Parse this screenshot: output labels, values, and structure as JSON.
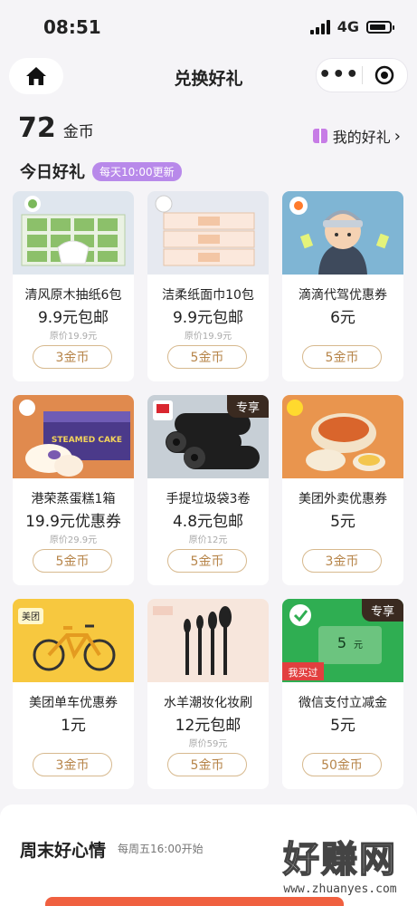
{
  "status": {
    "time": "08:51",
    "network": "4G"
  },
  "nav": {
    "title": "兑换好礼",
    "menu_icon": "more-dots-icon",
    "close_icon": "target-icon"
  },
  "coins": {
    "amount": "72",
    "unit": "金币"
  },
  "my_gifts": {
    "label": "我的好礼",
    "arrow": "›"
  },
  "today": {
    "title": "今日好礼",
    "badge": "每天10:00更新"
  },
  "products": [
    {
      "name": "清风原木抽纸6包",
      "price": "9.9元包邮",
      "original": "原价19.9元",
      "cost": "3金币",
      "tag": ""
    },
    {
      "name": "洁柔纸面巾10包",
      "price": "9.9元包邮",
      "original": "原价19.9元",
      "cost": "5金币",
      "tag": ""
    },
    {
      "name": "滴滴代驾优惠券",
      "price": "6元",
      "original": "",
      "cost": "5金币",
      "tag": ""
    },
    {
      "name": "港荣蒸蛋糕1箱",
      "price": "19.9元优惠券",
      "original": "原价29.9元",
      "cost": "5金币",
      "tag": ""
    },
    {
      "name": "手提垃圾袋3卷",
      "price": "4.8元包邮",
      "original": "原价12元",
      "cost": "5金币",
      "tag": "专享"
    },
    {
      "name": "美团外卖优惠券",
      "price": "5元",
      "original": "",
      "cost": "3金币",
      "tag": ""
    },
    {
      "name": "美团单车优惠券",
      "price": "1元",
      "original": "",
      "cost": "3金币",
      "tag": ""
    },
    {
      "name": "水羊潮妆化妆刷",
      "price": "12元包邮",
      "original": "原价59元",
      "cost": "5金币",
      "tag": ""
    },
    {
      "name": "微信支付立减金",
      "price": "5元",
      "original": "",
      "cost": "50金币",
      "tag": "专享"
    }
  ],
  "image_text": {
    "steamed_cake": "STEAMED CAKE",
    "meituan": "美团",
    "wechat_amount": "5",
    "wechat_unit": "元",
    "wechat_bought": "我买过"
  },
  "weekend": {
    "title": "周末好心情",
    "subtitle": "每周五16:00开始"
  },
  "watermark": {
    "big": "好赚网",
    "small": "www.zhuanyes.com"
  }
}
